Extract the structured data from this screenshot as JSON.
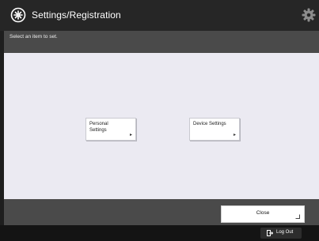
{
  "header": {
    "title": "Settings/Registration",
    "title_icon": "settings-registration-icon",
    "right_icon": "settings-icon"
  },
  "subheader": {
    "instruction": "Select an item to set."
  },
  "menu": {
    "personal_settings": "Personal\nSettings",
    "device_settings": "Device Settings"
  },
  "footer": {
    "close_label": "Close"
  },
  "bottom_bar": {
    "logout_label": "Log Out"
  },
  "colors": {
    "title_bar": "#262626",
    "subheader": "#4a4a4a",
    "content_bg": "#ebeaf2",
    "bottom_bar": "#141414"
  }
}
